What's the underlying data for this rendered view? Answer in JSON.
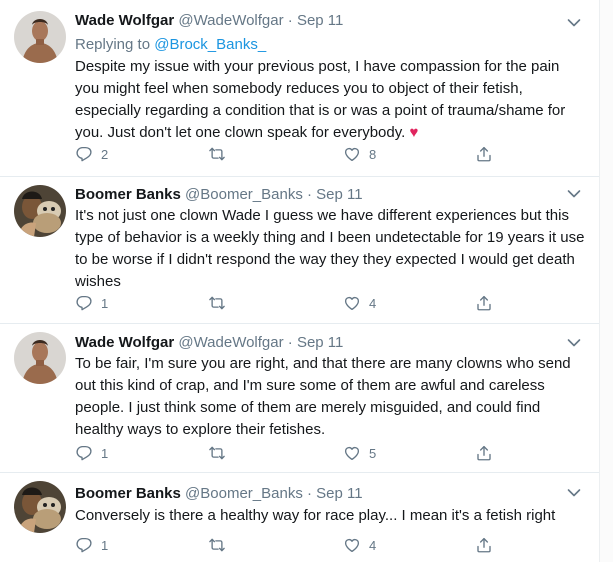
{
  "tweets": [
    {
      "author": "Wade Wolfgar",
      "handle": "@WadeWolfgar",
      "sep": "·",
      "date": "Sep 11",
      "replying_label": "Replying to",
      "replying_to": "@Brock_Banks_",
      "text": "Despite my issue with your previous post, I have compassion for the pain you might feel when somebody reduces you to object of their fetish, especially regarding a condition that is or was a point of trauma/shame for you. Just don't let one clown speak for everybody.",
      "emoji": "♥",
      "replies": "2",
      "retweets": "",
      "likes": "8"
    },
    {
      "author": "Boomer Banks",
      "handle": "@Boomer_Banks",
      "sep": "·",
      "date": "Sep 11",
      "text": "It's not just one clown Wade I guess we have different experiences but this type of behavior is a weekly thing and I been undetectable for 19 years it use to be worse if I didn't respond the way they they expected I would get death wishes",
      "replies": "1",
      "retweets": "",
      "likes": "4"
    },
    {
      "author": "Wade Wolfgar",
      "handle": "@WadeWolfgar",
      "sep": "·",
      "date": "Sep 11",
      "text": "To be fair, I'm sure you are right, and that there are many clowns who send out this kind of crap, and I'm sure some of them are awful and careless people. I just think some of them are merely misguided, and could find healthy ways to explore their fetishes.",
      "replies": "1",
      "retweets": "",
      "likes": "5"
    },
    {
      "author": "Boomer Banks",
      "handle": "@Boomer_Banks",
      "sep": "·",
      "date": "Sep 11",
      "text": "Conversely is there a healthy way for race play... I mean it's a fetish right",
      "replies": "1",
      "retweets": "",
      "likes": "4"
    }
  ],
  "icons": {
    "reply": "reply-icon",
    "retweet": "retweet-icon",
    "like": "like-icon",
    "share": "share-icon",
    "more": "chevron-down-icon"
  },
  "colors": {
    "link": "#1b95e0",
    "muted": "#657786",
    "heart": "#e0245e"
  }
}
